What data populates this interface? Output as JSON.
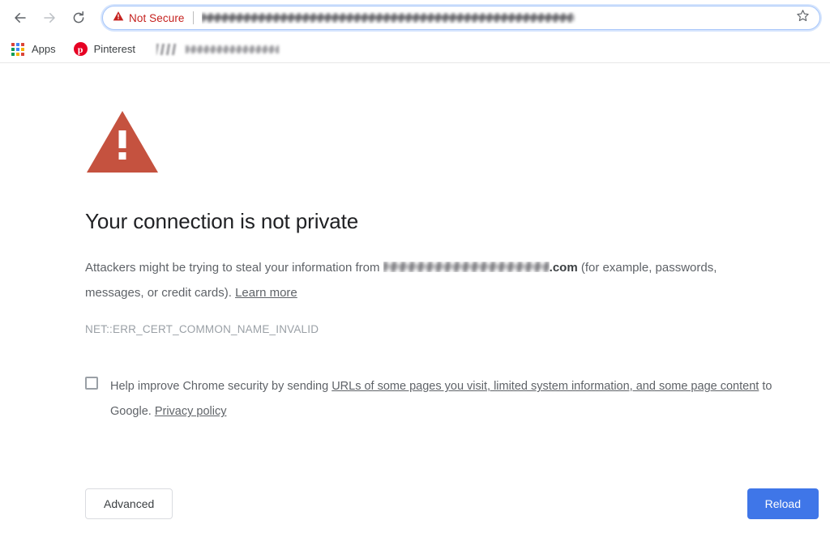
{
  "browser": {
    "nav": {
      "back_icon": "arrow-left-icon",
      "forward_icon": "arrow-right-icon",
      "reload_icon": "reload-icon"
    },
    "omnibox": {
      "security_icon": "warning-triangle-icon",
      "security_label": "Not Secure",
      "url_value": "",
      "url_redacted": true,
      "bookmark_icon": "star-outline-icon"
    },
    "bookmarks": {
      "apps_icon": "apps-grid-icon",
      "apps_label": "Apps",
      "items": [
        {
          "icon": "pinterest-icon",
          "glyph": "p",
          "label": "Pinterest"
        },
        {
          "icon": "favicon-redacted",
          "label": "",
          "redacted": true
        }
      ]
    }
  },
  "interstitial": {
    "warning_icon": "error-triangle-icon",
    "headline": "Your connection is not private",
    "body": {
      "lead": "Attackers might be trying to steal your information from ",
      "host_redacted": true,
      "host_tld": ".com",
      "middle": " (for example, passwords, messages, or credit cards). ",
      "learn_more": "Learn more"
    },
    "error_code": "NET::ERR_CERT_COMMON_NAME_INVALID",
    "optin": {
      "checked": false,
      "prefix": "Help improve Chrome security by sending ",
      "link": "URLs of some pages you visit, limited system information, and some page content",
      "middle": " to Google. ",
      "privacy_link": "Privacy policy"
    },
    "buttons": {
      "advanced": "Advanced",
      "reload": "Reload"
    }
  },
  "colors": {
    "warning_red": "#c5523f",
    "not_secure_red": "#c5221f",
    "reload_blue": "#3f76e8",
    "text_primary": "#202124",
    "text_secondary": "#5f6368",
    "text_muted": "#9aa0a6",
    "apps_dots": [
      "#db4437",
      "#4285f4",
      "#db4437",
      "#0f9d58",
      "#4285f4",
      "#f4b400",
      "#0f9d58",
      "#f4b400",
      "#db4437"
    ]
  }
}
